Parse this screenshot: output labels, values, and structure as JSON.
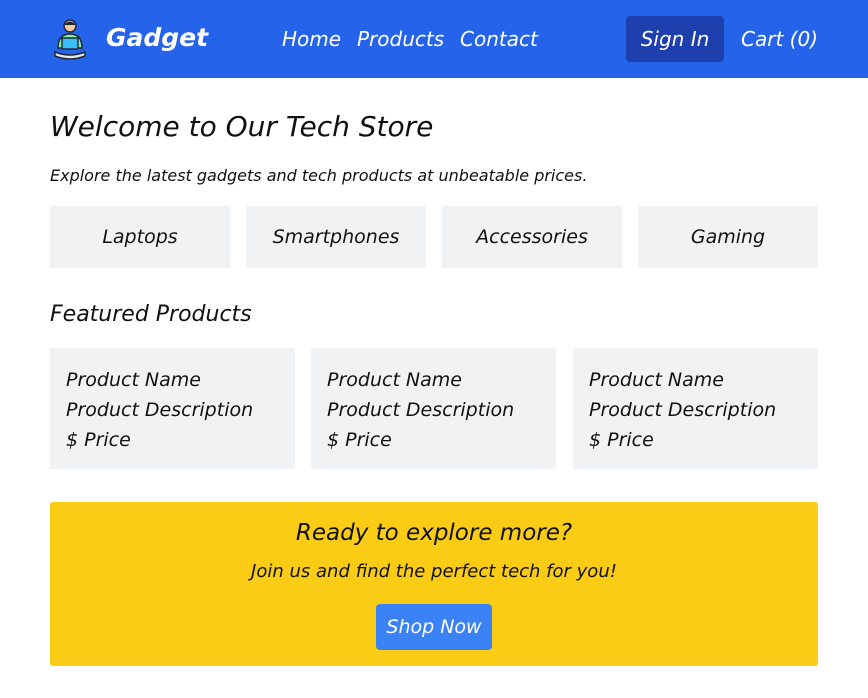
{
  "header": {
    "logo_icon": "person-with-laptop-icon",
    "brand": "Gadget",
    "nav": {
      "home": "Home",
      "products": "Products",
      "contact": "Contact"
    },
    "sign_in": "Sign In",
    "cart": "Cart (0)"
  },
  "hero": {
    "title": "Welcome to Our Tech Store",
    "subtitle": "Explore the latest gadgets and tech products at unbeatable prices."
  },
  "categories": [
    {
      "label": "Laptops"
    },
    {
      "label": "Smartphones"
    },
    {
      "label": "Accessories"
    },
    {
      "label": "Gaming"
    }
  ],
  "featured": {
    "title": "Featured Products",
    "products": [
      {
        "name": "Product Name",
        "description": "Product Description",
        "price": "$ Price"
      },
      {
        "name": "Product Name",
        "description": "Product Description",
        "price": "$ Price"
      },
      {
        "name": "Product Name",
        "description": "Product Description",
        "price": "$ Price"
      }
    ]
  },
  "cta": {
    "title": "Ready to explore more?",
    "subtitle": "Join us and find the perfect tech for you!",
    "button": "Shop Now"
  },
  "colors": {
    "header_bg": "#2563eb",
    "sign_in_bg": "#1e40af",
    "card_bg": "#f1f2f4",
    "cta_bg": "#facc15",
    "cta_button_bg": "#3b82f6"
  }
}
